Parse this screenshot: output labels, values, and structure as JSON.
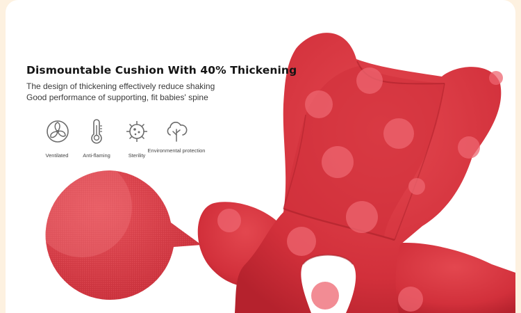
{
  "banner": {
    "headline": "Dismountable Cushion With 40% Thickening",
    "description_lines": [
      "The design of thickening effectively reduce shaking",
      "Good performance of supporting, fit babies' spine"
    ]
  },
  "features": [
    {
      "label": "Ventilated",
      "icon": "ventilation-fan-icon"
    },
    {
      "label": "Anti-flaming",
      "icon": "thermometer-icon"
    },
    {
      "label": "Sterility",
      "icon": "virus-sterility-icon"
    },
    {
      "label": "Environmental protection",
      "icon": "cloud-tree-icon"
    }
  ],
  "colors": {
    "background": "#fdf1e0",
    "card": "#ffffff",
    "cushion_red": "#d8343f",
    "polka_dot": "#ec5d68",
    "headline": "#151515",
    "icon_stroke": "#6b6b6b"
  },
  "images": {
    "fabric_closeup": "red knit fabric close-up magnifier",
    "cushion": "red polka-dot baby seat cushion"
  }
}
